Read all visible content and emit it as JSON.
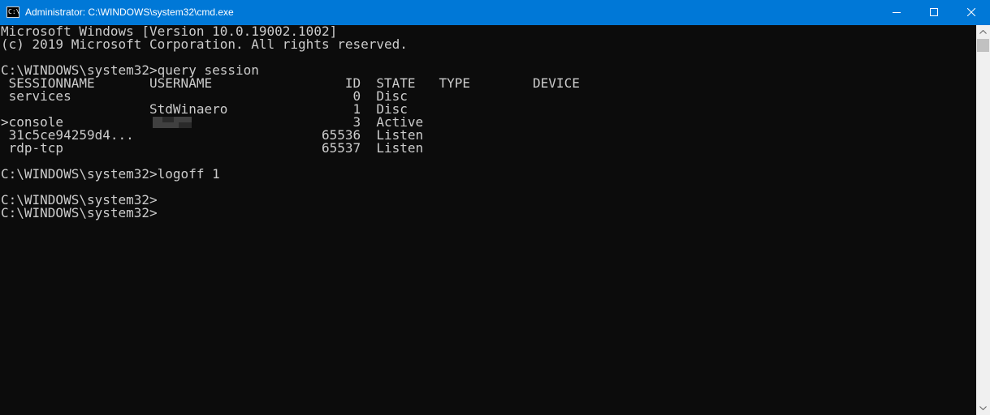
{
  "window": {
    "title": "Administrator: C:\\WINDOWS\\system32\\cmd.exe",
    "icon": "cmd-icon",
    "icon_glyph": "C:\\"
  },
  "console": {
    "lines": [
      "Microsoft Windows [Version 10.0.19002.1002]",
      "(c) 2019 Microsoft Corporation. All rights reserved.",
      "",
      "C:\\WINDOWS\\system32>query session",
      " SESSIONNAME       USERNAME                 ID  STATE   TYPE        DEVICE",
      " services                                    0  Disc",
      "                   StdWinaero                1  Disc",
      ">console                                     3  Active",
      " 31c5ce94259d4...                        65536  Listen",
      " rdp-tcp                                 65537  Listen",
      "",
      "C:\\WINDOWS\\system32>logoff 1",
      "",
      "C:\\WINDOWS\\system32>",
      "C:\\WINDOWS\\system32>"
    ]
  },
  "colors": {
    "titlebar": "#0078d7",
    "console_bg": "#0c0c0c",
    "console_text": "#cccccc"
  }
}
